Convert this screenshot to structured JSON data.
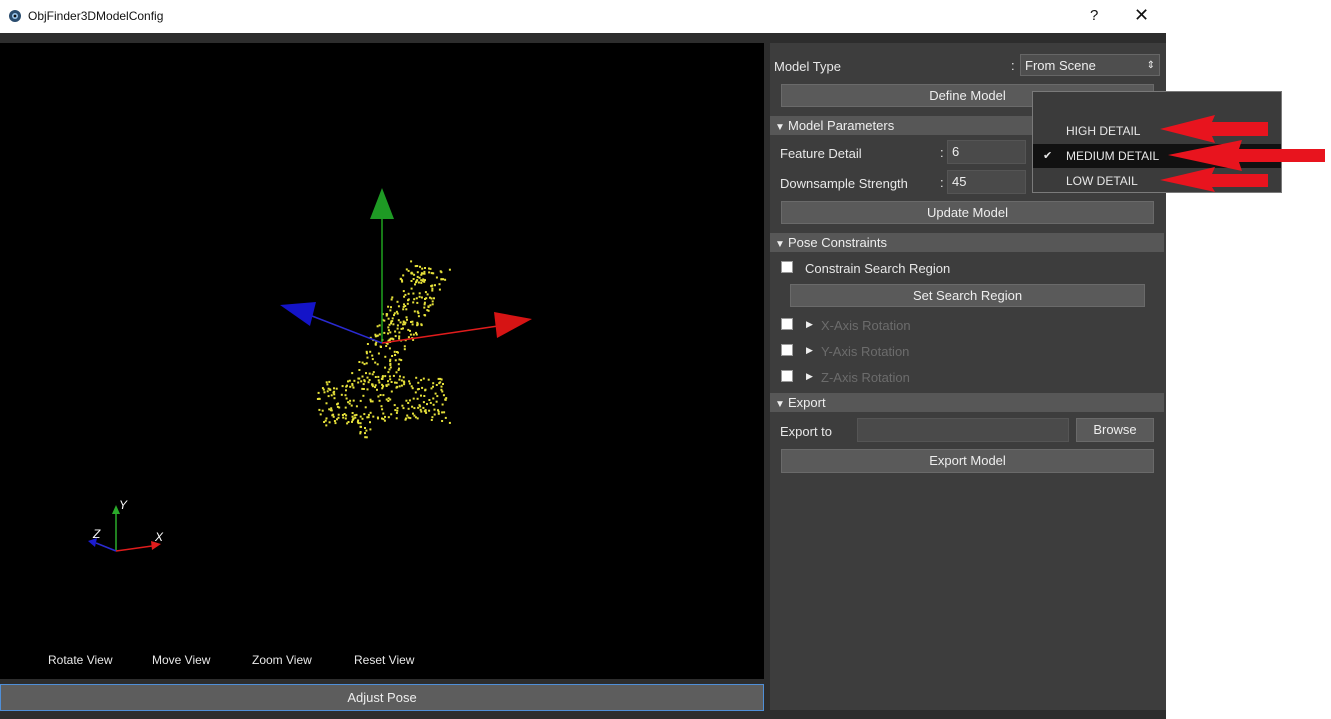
{
  "window": {
    "title": "ObjFinder3DModelConfig",
    "help": "?",
    "close": "✕"
  },
  "viewport": {
    "buttons": [
      "Rotate View",
      "Move View",
      "Zoom View",
      "Reset View"
    ],
    "axes": {
      "x": "X",
      "y": "Y",
      "z": "Z"
    },
    "adjust_pose": "Adjust Pose"
  },
  "panel": {
    "model_type": {
      "label": "Model Type",
      "value": "From Scene",
      "arrow": "⇕"
    },
    "define_model": "Define Model",
    "model_parameters": {
      "header": "Model Parameters",
      "feature_detail": {
        "label": "Feature Detail",
        "value": "6"
      },
      "downsample": {
        "label": "Downsample Strength",
        "value": "45"
      },
      "update": "Update Model"
    },
    "pose_constraints": {
      "header": "Pose Constraints",
      "constrain": "Constrain Search Region",
      "set_region": "Set Search Region",
      "x_rot": "X-Axis Rotation",
      "y_rot": "Y-Axis Rotation",
      "z_rot": "Z-Axis Rotation"
    },
    "export": {
      "header": "Export",
      "export_to": "Export to",
      "path": "",
      "browse": "Browse",
      "export_model": "Export Model"
    }
  },
  "dropdown": {
    "options": [
      {
        "label": "HIGH DETAIL",
        "selected": false
      },
      {
        "label": "MEDIUM DETAIL",
        "selected": true
      },
      {
        "label": "LOW DETAIL",
        "selected": false
      }
    ]
  },
  "colors": {
    "accent": "#4f8fd8",
    "annotation_arrow": "#e8141e",
    "points": "#e6e13a"
  }
}
